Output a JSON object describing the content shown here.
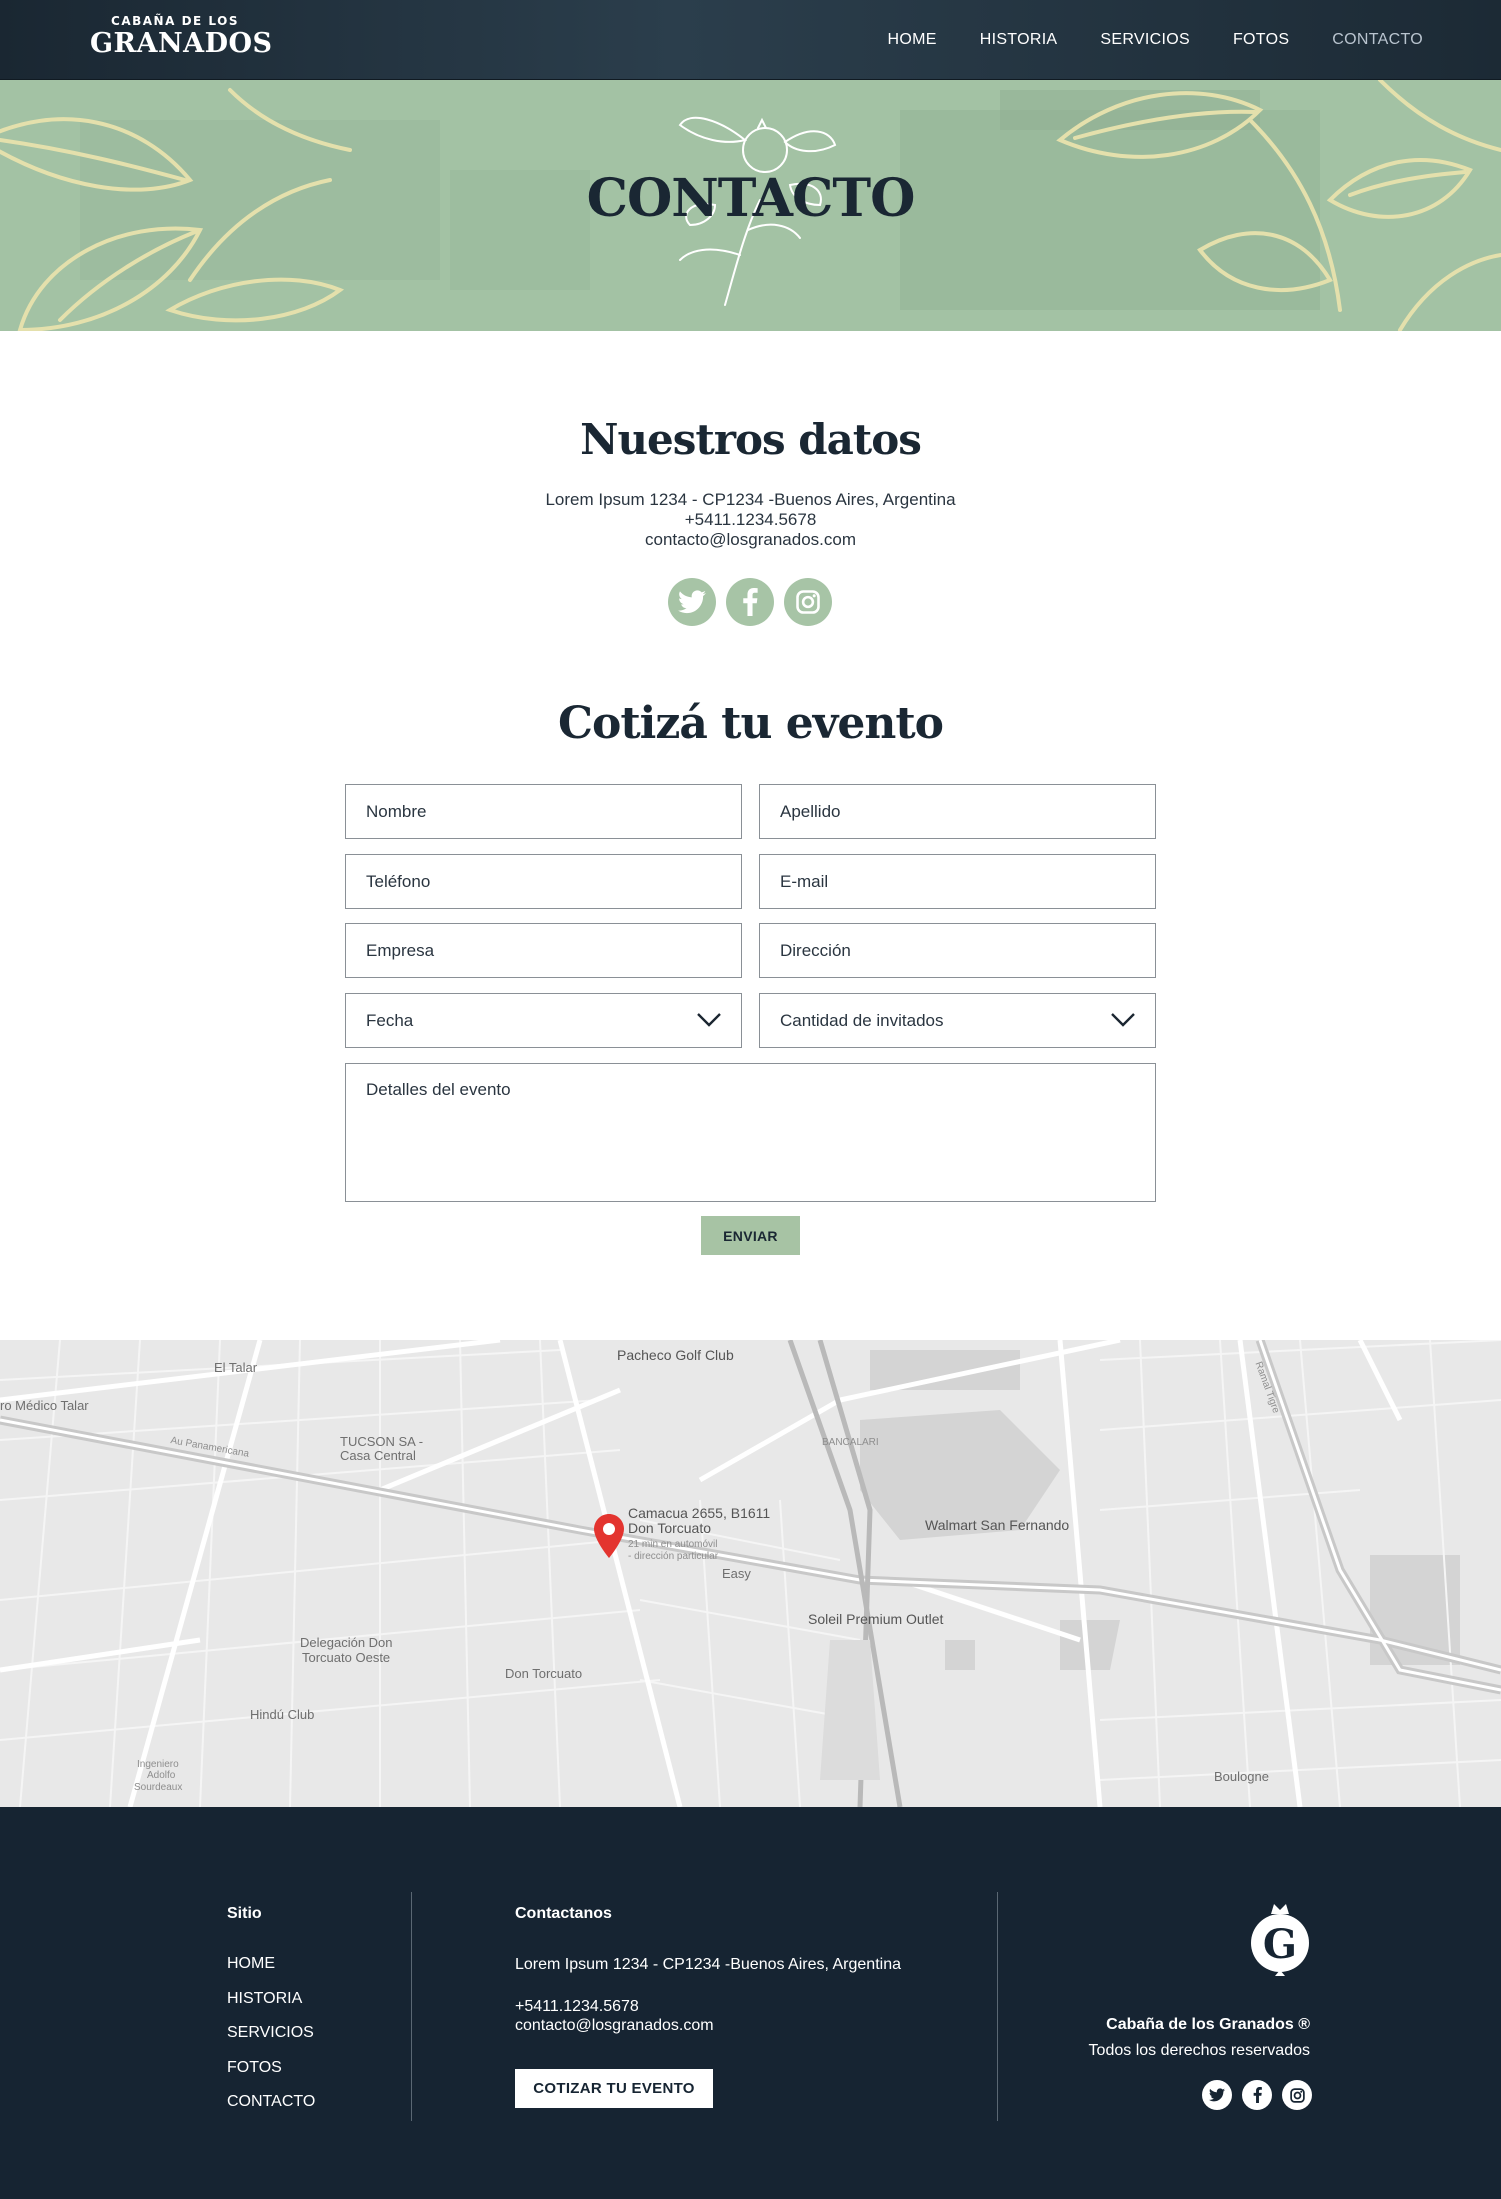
{
  "header": {
    "logo_top": "CABAÑA DE LOS",
    "logo_main": "GRANADOS",
    "nav": [
      {
        "label": "HOME",
        "active": false
      },
      {
        "label": "HISTORIA",
        "active": false
      },
      {
        "label": "SERVICIOS",
        "active": false
      },
      {
        "label": "FOTOS",
        "active": false
      },
      {
        "label": "CONTACTO",
        "active": true
      }
    ]
  },
  "hero": {
    "title": "CONTACTO"
  },
  "datos": {
    "title": "Nuestros datos",
    "address": "Lorem Ipsum 1234 - CP1234 -Buenos Aires, Argentina",
    "phone": "+5411.1234.5678",
    "email": "contacto@losgranados.com",
    "socials": [
      "twitter-icon",
      "facebook-icon",
      "instagram-icon"
    ]
  },
  "form": {
    "title": "Cotizá tu evento",
    "nombre": "Nombre",
    "apellido": "Apellido",
    "telefono": "Teléfono",
    "email": "E-mail",
    "empresa": "Empresa",
    "direccion": "Dirección",
    "fecha": "Fecha",
    "invitados": "Cantidad de invitados",
    "detalles": "Detalles del evento",
    "submit": "ENVIAR"
  },
  "map": {
    "labels": {
      "pacheco_golf": "Pacheco Golf Club",
      "el_talar": "El Talar",
      "medico_talar": "ro Médico Talar",
      "tucson_1": "TUCSON SA -",
      "tucson_2": "Casa Central",
      "bancalari": "BANCALARI",
      "walmart": "Walmart San Fernando",
      "camacua_1": "Camacua 2655, B1611",
      "camacua_2": "Don Torcuato",
      "camacua_3": "21 min en automóvil",
      "camacua_4": "- dirección particular",
      "easy": "Easy",
      "soleil": "Soleil Premium Outlet",
      "delegacion_1": "Delegación Don",
      "delegacion_2": "Torcuato Oeste",
      "don_torcuato": "Don Torcuato",
      "hindu": "Hindú Club",
      "ingeniero_1": "Ingeniero",
      "ingeniero_2": "Adolfo",
      "ingeniero_3": "Sourdeaux",
      "boulogne": "Boulogne",
      "au_panamericana": "Au Panamericana",
      "ramal_tigre": "Ramal Tigre"
    }
  },
  "footer": {
    "sitio_title": "Sitio",
    "links": [
      "HOME",
      "HISTORIA",
      "SERVICIOS",
      "FOTOS",
      "CONTACTO"
    ],
    "contact_title": "Contactanos",
    "address": "Lorem Ipsum 1234 - CP1234 -Buenos Aires, Argentina",
    "phone": "+5411.1234.5678",
    "email": "contacto@losgranados.com",
    "cta": "COTIZAR TU EVENTO",
    "brand": "Cabaña de los Granados ®",
    "rights": "Todos los derechos reservados",
    "emblem_letter": "G"
  },
  "colors": {
    "navy": "#162432",
    "sage": "#a7c4a6",
    "hero_line": "#e6e2ae"
  }
}
